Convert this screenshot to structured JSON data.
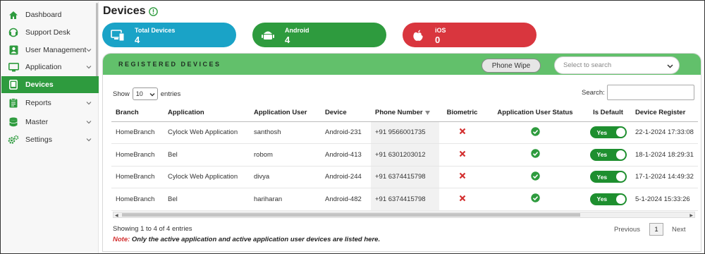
{
  "sidebar": {
    "items": [
      {
        "label": "Dashboard",
        "icon": "home-icon",
        "has_chevron": false
      },
      {
        "label": "Support Desk",
        "icon": "headset-icon",
        "has_chevron": false
      },
      {
        "label": "User Management",
        "icon": "user-card-icon",
        "has_chevron": true
      },
      {
        "label": "Application",
        "icon": "monitor-icon",
        "has_chevron": true
      },
      {
        "label": "Devices",
        "icon": "tablet-icon",
        "has_chevron": false,
        "active": true
      },
      {
        "label": "Reports",
        "icon": "clipboard-icon",
        "has_chevron": true
      },
      {
        "label": "Master",
        "icon": "database-icon",
        "has_chevron": true
      },
      {
        "label": "Settings",
        "icon": "gears-icon",
        "has_chevron": true
      }
    ]
  },
  "header": {
    "title": "Devices"
  },
  "stats": {
    "total": {
      "label": "Total Devices",
      "value": "4"
    },
    "android": {
      "label": "Android",
      "value": "4"
    },
    "ios": {
      "label": "iOS",
      "value": "0"
    }
  },
  "panel": {
    "title": "REGISTERED DEVICES",
    "phone_wipe_label": "Phone Wipe",
    "select_placeholder": "Select to search"
  },
  "table_controls": {
    "show_label": "Show",
    "entries_value": "10",
    "entries_label": "entries",
    "search_label": "Search:"
  },
  "table": {
    "columns": [
      "Branch",
      "Application",
      "Application User",
      "Device",
      "Phone Number",
      "Biometric",
      "Application User Status",
      "Is Default",
      "Device Register"
    ],
    "rows": [
      {
        "branch": "HomeBranch",
        "application": "Cylock Web Application",
        "user": "santhosh",
        "device": "Android-231",
        "phone": "+91 9566001735",
        "biometric": false,
        "status": true,
        "is_default": "Yes",
        "registered": "22-1-2024 17:33:08"
      },
      {
        "branch": "HomeBranch",
        "application": "Bel",
        "user": "robom",
        "device": "Android-413",
        "phone": "+91 6301203012",
        "biometric": false,
        "status": true,
        "is_default": "Yes",
        "registered": "18-1-2024 18:29:31"
      },
      {
        "branch": "HomeBranch",
        "application": "Cylock Web Application",
        "user": "divya",
        "device": "Android-244",
        "phone": "+91 6374415798",
        "biometric": false,
        "status": true,
        "is_default": "Yes",
        "registered": "17-1-2024 14:49:32"
      },
      {
        "branch": "HomeBranch",
        "application": "Bel",
        "user": "hariharan",
        "device": "Android-482",
        "phone": "+91 6374415798",
        "biometric": false,
        "status": true,
        "is_default": "Yes",
        "registered": "5-1-2024 15:33:26"
      }
    ]
  },
  "footer": {
    "showing": "Showing 1 to 4 of 4 entries",
    "note_label": "Note:",
    "note_text": " Only the active application and active application user devices are listed here.",
    "prev_label": "Previous",
    "page": "1",
    "next_label": "Next"
  },
  "colors": {
    "accent": "#2e9b3e",
    "total": "#1aa3c7",
    "android": "#2e9b3e",
    "ios": "#d9363e",
    "panel_head": "#62c06b"
  }
}
